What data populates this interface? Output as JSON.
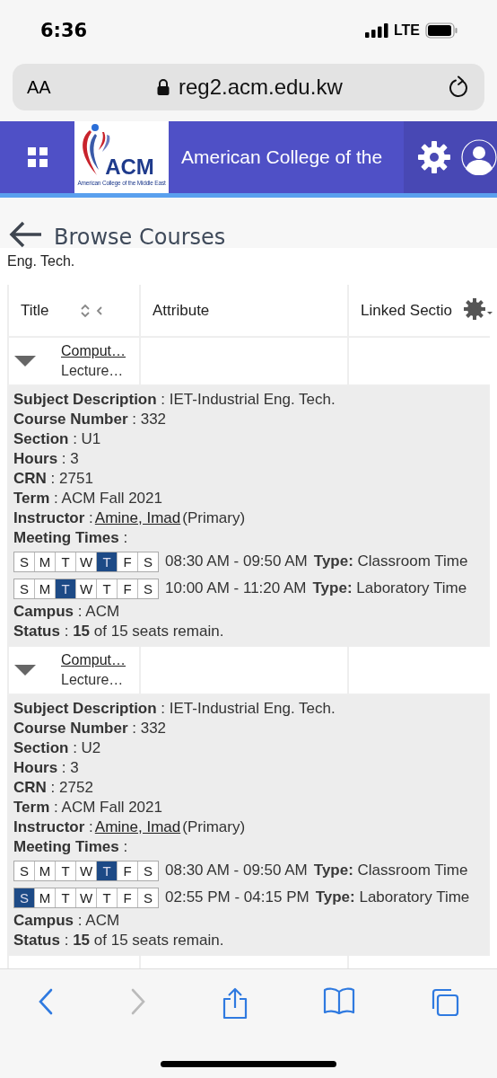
{
  "status_bar": {
    "time": "6:36",
    "network": "LTE"
  },
  "browser": {
    "text_size": "AA",
    "url": "reg2.acm.edu.kw"
  },
  "header": {
    "logo_text": "ACM",
    "logo_caption": "American College of the Middle East",
    "title": "American College of the"
  },
  "page": {
    "back_title": "Browse Courses",
    "subtitle": "Eng. Tech."
  },
  "table": {
    "columns": [
      {
        "label": "Title",
        "sortable": true
      },
      {
        "label": "Attribute",
        "sortable": false
      },
      {
        "label": "Linked Sectio",
        "sortable": false
      }
    ],
    "rows": [
      {
        "expanded": true,
        "title": "Comput…",
        "schedule": "Lecture…",
        "details": [
          {
            "kind": "text",
            "label": "Subject Description",
            "sep": ":",
            "value": "IET-Industrial Eng. Tech."
          },
          {
            "kind": "text",
            "label": "Course Number",
            "sep": ":",
            "value": "332"
          },
          {
            "kind": "text",
            "label": "Section",
            "sep": ":",
            "value": "U1"
          },
          {
            "kind": "text",
            "label": "Hours",
            "sep": ":",
            "value": "3"
          },
          {
            "kind": "text",
            "label": "CRN",
            "sep": ":",
            "value": "2751"
          },
          {
            "kind": "text",
            "label": "Term",
            "sep": ":",
            "value": "ACM Fall 2021"
          },
          {
            "kind": "link",
            "label": "Instructor",
            "sep": ":",
            "value": "Amine, Imad",
            "suffix": "(Primary)"
          },
          {
            "kind": "meetings",
            "label": "Meeting Times",
            "sep": ":",
            "meetings": [
              {
                "days": [
                  {
                    "letter": "S",
                    "selected": false
                  },
                  {
                    "letter": "M",
                    "selected": false
                  },
                  {
                    "letter": "T",
                    "selected": false
                  },
                  {
                    "letter": "W",
                    "selected": false
                  },
                  {
                    "letter": "T",
                    "selected": true
                  },
                  {
                    "letter": "F",
                    "selected": false
                  },
                  {
                    "letter": "S",
                    "selected": false
                  }
                ],
                "time": "08:30 AM - 09:50 AM",
                "type_label": "Type:",
                "type_value": "Classroom Time"
              },
              {
                "days": [
                  {
                    "letter": "S",
                    "selected": false
                  },
                  {
                    "letter": "M",
                    "selected": false
                  },
                  {
                    "letter": "T",
                    "selected": true
                  },
                  {
                    "letter": "W",
                    "selected": false
                  },
                  {
                    "letter": "T",
                    "selected": false
                  },
                  {
                    "letter": "F",
                    "selected": false
                  },
                  {
                    "letter": "S",
                    "selected": false
                  }
                ],
                "time": "10:00 AM - 11:20 AM",
                "type_label": "Type:",
                "type_value": "Laboratory Time"
              }
            ]
          },
          {
            "kind": "text",
            "label": "Campus",
            "sep": ":",
            "value": "ACM"
          },
          {
            "kind": "text",
            "label": "Status",
            "sep": ":",
            "value": "**15** of 15 seats remain."
          }
        ]
      },
      {
        "expanded": true,
        "title": "Comput…",
        "schedule": "Lecture…",
        "details": [
          {
            "kind": "text",
            "label": "Subject Description",
            "sep": ":",
            "value": "IET-Industrial Eng. Tech."
          },
          {
            "kind": "text",
            "label": "Course Number",
            "sep": ":",
            "value": "332"
          },
          {
            "kind": "text",
            "label": "Section",
            "sep": ":",
            "value": "U2"
          },
          {
            "kind": "text",
            "label": "Hours",
            "sep": ":",
            "value": "3"
          },
          {
            "kind": "text",
            "label": "CRN",
            "sep": ":",
            "value": "2752"
          },
          {
            "kind": "text",
            "label": "Term",
            "sep": ":",
            "value": "ACM Fall 2021"
          },
          {
            "kind": "link",
            "label": "Instructor",
            "sep": ":",
            "value": "Amine, Imad",
            "suffix": "(Primary)"
          },
          {
            "kind": "meetings",
            "label": "Meeting Times",
            "sep": ":",
            "meetings": [
              {
                "days": [
                  {
                    "letter": "S",
                    "selected": false
                  },
                  {
                    "letter": "M",
                    "selected": false
                  },
                  {
                    "letter": "T",
                    "selected": false
                  },
                  {
                    "letter": "W",
                    "selected": false
                  },
                  {
                    "letter": "T",
                    "selected": true
                  },
                  {
                    "letter": "F",
                    "selected": false
                  },
                  {
                    "letter": "S",
                    "selected": false
                  }
                ],
                "time": "08:30 AM - 09:50 AM",
                "type_label": "Type:",
                "type_value": "Classroom Time"
              },
              {
                "days": [
                  {
                    "letter": "S",
                    "selected": true
                  },
                  {
                    "letter": "M",
                    "selected": false
                  },
                  {
                    "letter": "T",
                    "selected": false
                  },
                  {
                    "letter": "W",
                    "selected": false
                  },
                  {
                    "letter": "T",
                    "selected": false
                  },
                  {
                    "letter": "F",
                    "selected": false
                  },
                  {
                    "letter": "S",
                    "selected": false
                  }
                ],
                "time": "02:55 PM - 04:15 PM",
                "type_label": "Type:",
                "type_value": "Laboratory Time"
              }
            ]
          },
          {
            "kind": "text",
            "label": "Campus",
            "sep": ":",
            "value": "ACM"
          },
          {
            "kind": "text",
            "label": "Status",
            "sep": ":",
            "value": "**15** of 15 seats remain."
          }
        ]
      }
    ]
  },
  "toolbar": {
    "back_enabled": true,
    "forward_enabled": false
  }
}
